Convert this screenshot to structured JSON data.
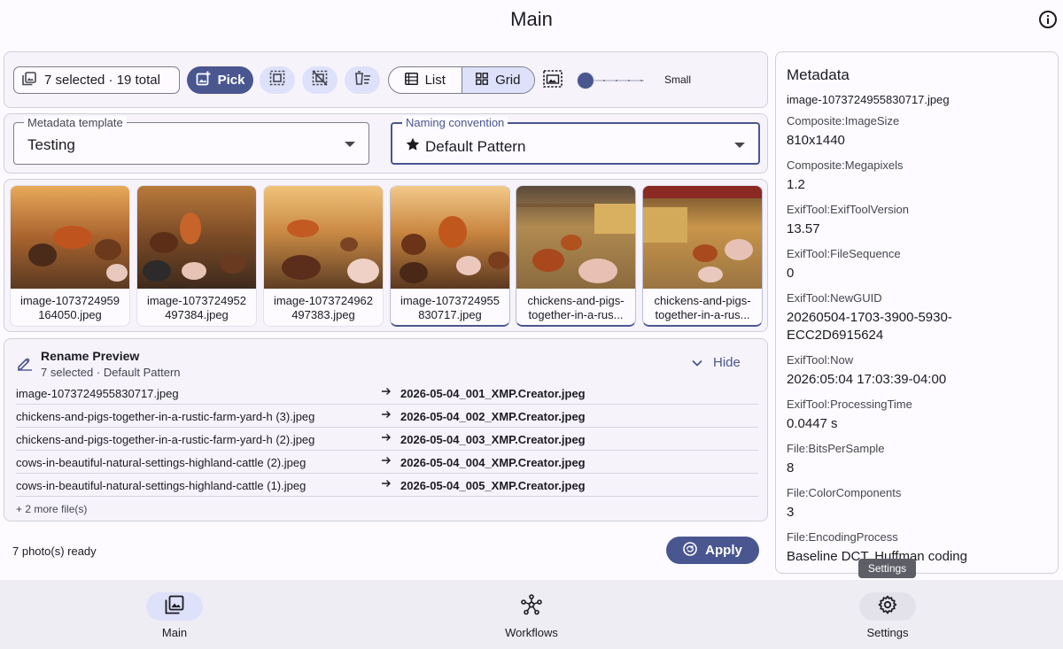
{
  "app": {
    "title": "Main"
  },
  "toolbar": {
    "selection_text": "7 selected · 19 total",
    "pick_label": "Pick",
    "view_list_label": "List",
    "view_grid_label": "Grid",
    "active_view": "Grid",
    "size_label": "Small",
    "thumb_size_level": 0
  },
  "selectors": {
    "template_label": "Metadata template",
    "template_value": "Testing",
    "naming_label": "Naming convention",
    "naming_value": "Default Pattern"
  },
  "thumbnails": [
    {
      "line1": "image-1073724959",
      "line2": "164050.jpeg",
      "selected": false,
      "icon": "photo-icon"
    },
    {
      "line1": "image-1073724952",
      "line2": "497384.jpeg",
      "selected": false,
      "icon": "photo-icon"
    },
    {
      "line1": "image-1073724962",
      "line2": "497383.jpeg",
      "selected": false,
      "icon": "photo-icon"
    },
    {
      "line1": "image-1073724955",
      "line2": "830717.jpeg",
      "selected": true,
      "icon": "photo-icon"
    },
    {
      "line1": "chickens-and-pigs-",
      "line2": "together-in-a-rus...",
      "selected": true,
      "icon": "photo-icon"
    },
    {
      "line1": "chickens-and-pigs-",
      "line2": "together-in-a-rus...",
      "selected": true,
      "icon": "photo-icon"
    }
  ],
  "rename": {
    "title": "Rename Preview",
    "subtitle": "7 selected · Default Pattern",
    "hide_label": "Hide",
    "rows": [
      {
        "old": "image-1073724955830717.jpeg",
        "new": "2026-05-04_001_XMP.Creator.jpeg"
      },
      {
        "old": "chickens-and-pigs-together-in-a-rustic-farm-yard-h (3).jpeg",
        "new": "2026-05-04_002_XMP.Creator.jpeg"
      },
      {
        "old": "chickens-and-pigs-together-in-a-rustic-farm-yard-h (2).jpeg",
        "new": "2026-05-04_003_XMP.Creator.jpeg"
      },
      {
        "old": "cows-in-beautiful-natural-settings-highland-cattle (2).jpeg",
        "new": "2026-05-04_004_XMP.Creator.jpeg"
      },
      {
        "old": "cows-in-beautiful-natural-settings-highland-cattle (1).jpeg",
        "new": "2026-05-04_005_XMP.Creator.jpeg"
      }
    ],
    "more": "+ 2 more file(s)"
  },
  "footer": {
    "status": "7 photo(s) ready",
    "apply_label": "Apply"
  },
  "metadata": {
    "title": "Metadata",
    "file": "image-1073724955830717.jpeg",
    "entries": [
      {
        "key": "Composite:ImageSize",
        "value": "810x1440"
      },
      {
        "key": "Composite:Megapixels",
        "value": "1.2"
      },
      {
        "key": "ExifTool:ExifToolVersion",
        "value": "13.57"
      },
      {
        "key": "ExifTool:FileSequence",
        "value": "0"
      },
      {
        "key": "ExifTool:NewGUID",
        "value": "20260504-1703-3900-5930-",
        "value2": "ECC2D6915624"
      },
      {
        "key": "ExifTool:Now",
        "value": "2026:05:04 17:03:39-04:00"
      },
      {
        "key": "ExifTool:ProcessingTime",
        "value": "0.0447 s"
      },
      {
        "key": "File:BitsPerSample",
        "value": "8"
      },
      {
        "key": "File:ColorComponents",
        "value": "3"
      },
      {
        "key": "File:EncodingProcess",
        "value": "Baseline DCT, Huffman coding"
      }
    ]
  },
  "tooltip": {
    "text": "Settings"
  },
  "nav": {
    "items": [
      {
        "label": "Main",
        "icon": "photo-library-icon",
        "active": true
      },
      {
        "label": "Workflows",
        "icon": "workflow-hub-icon",
        "active": false
      },
      {
        "label": "Settings",
        "icon": "gear-icon",
        "active": false
      }
    ]
  },
  "colors": {
    "accent": "#4a5690",
    "accent_container": "#dde1f9",
    "surface": "#f6f3fb",
    "nav_bg": "#efedf4"
  }
}
